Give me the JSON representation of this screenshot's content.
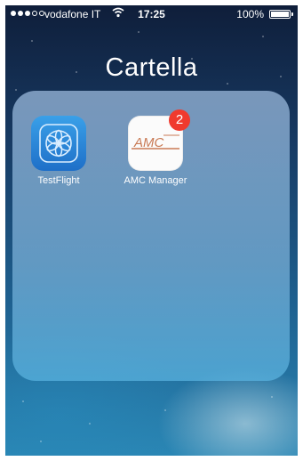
{
  "status_bar": {
    "carrier": "vodafone IT",
    "time": "17:25",
    "battery_percent": "100%",
    "signal_bars_filled": 3,
    "signal_bars_total": 5
  },
  "folder": {
    "title": "Cartella",
    "apps": [
      {
        "label": "TestFlight",
        "icon": "testflight-icon"
      },
      {
        "label": "AMC Manager",
        "icon": "amc-manager-icon",
        "icon_text": "AMC",
        "badge": "2"
      }
    ]
  },
  "colors": {
    "badge": "#f03a2e",
    "testflight_blue": "#1e6fc8",
    "amc_logo": "#c97a55"
  }
}
